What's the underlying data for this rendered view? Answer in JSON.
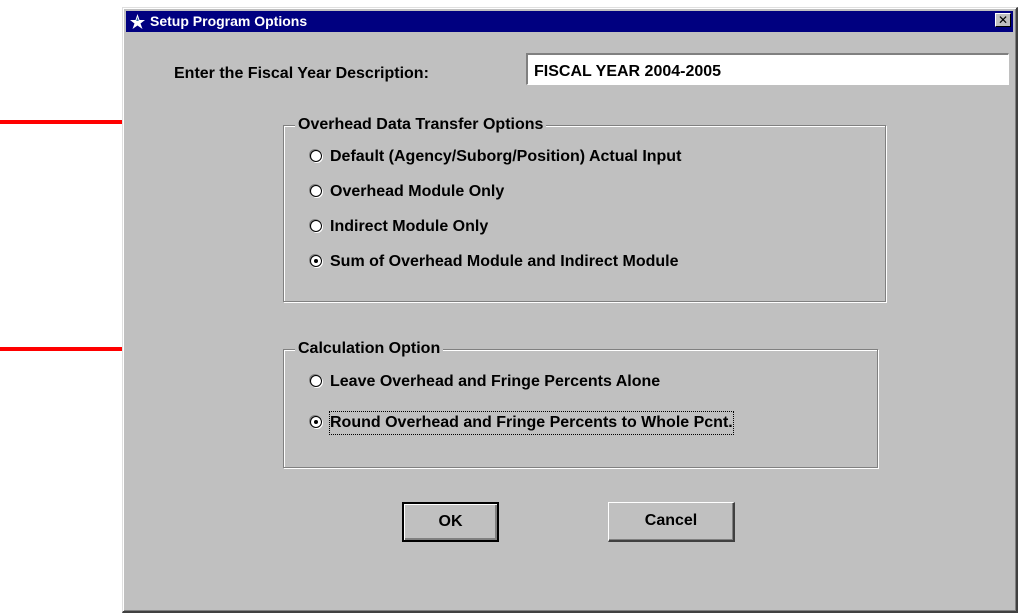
{
  "window": {
    "title": "Setup Program Options",
    "close_glyph": "✕",
    "colors": {
      "face": "#c0c0c0",
      "titlebar": "#000080",
      "annotation_arrow": "#ff0000"
    }
  },
  "fiscal_year": {
    "label": "Enter the Fiscal Year Description:",
    "value": "FISCAL YEAR 2004-2005"
  },
  "overhead_group": {
    "legend": "Overhead Data Transfer Options",
    "options": [
      {
        "label": "Default (Agency/Suborg/Position) Actual Input",
        "selected": false
      },
      {
        "label": "Overhead Module Only",
        "selected": false
      },
      {
        "label": "Indirect Module Only",
        "selected": false
      },
      {
        "label": "Sum of Overhead Module and Indirect Module",
        "selected": true
      }
    ]
  },
  "calculation_group": {
    "legend": "Calculation Option",
    "options": [
      {
        "label": "Leave Overhead and Fringe Percents Alone",
        "selected": false
      },
      {
        "label": "Round Overhead and Fringe Percents to Whole Pcnt.",
        "selected": true
      }
    ]
  },
  "buttons": {
    "ok": "OK",
    "cancel": "Cancel"
  },
  "icons": {
    "app": "app-icon",
    "arrow": "red-arrow-icon"
  }
}
